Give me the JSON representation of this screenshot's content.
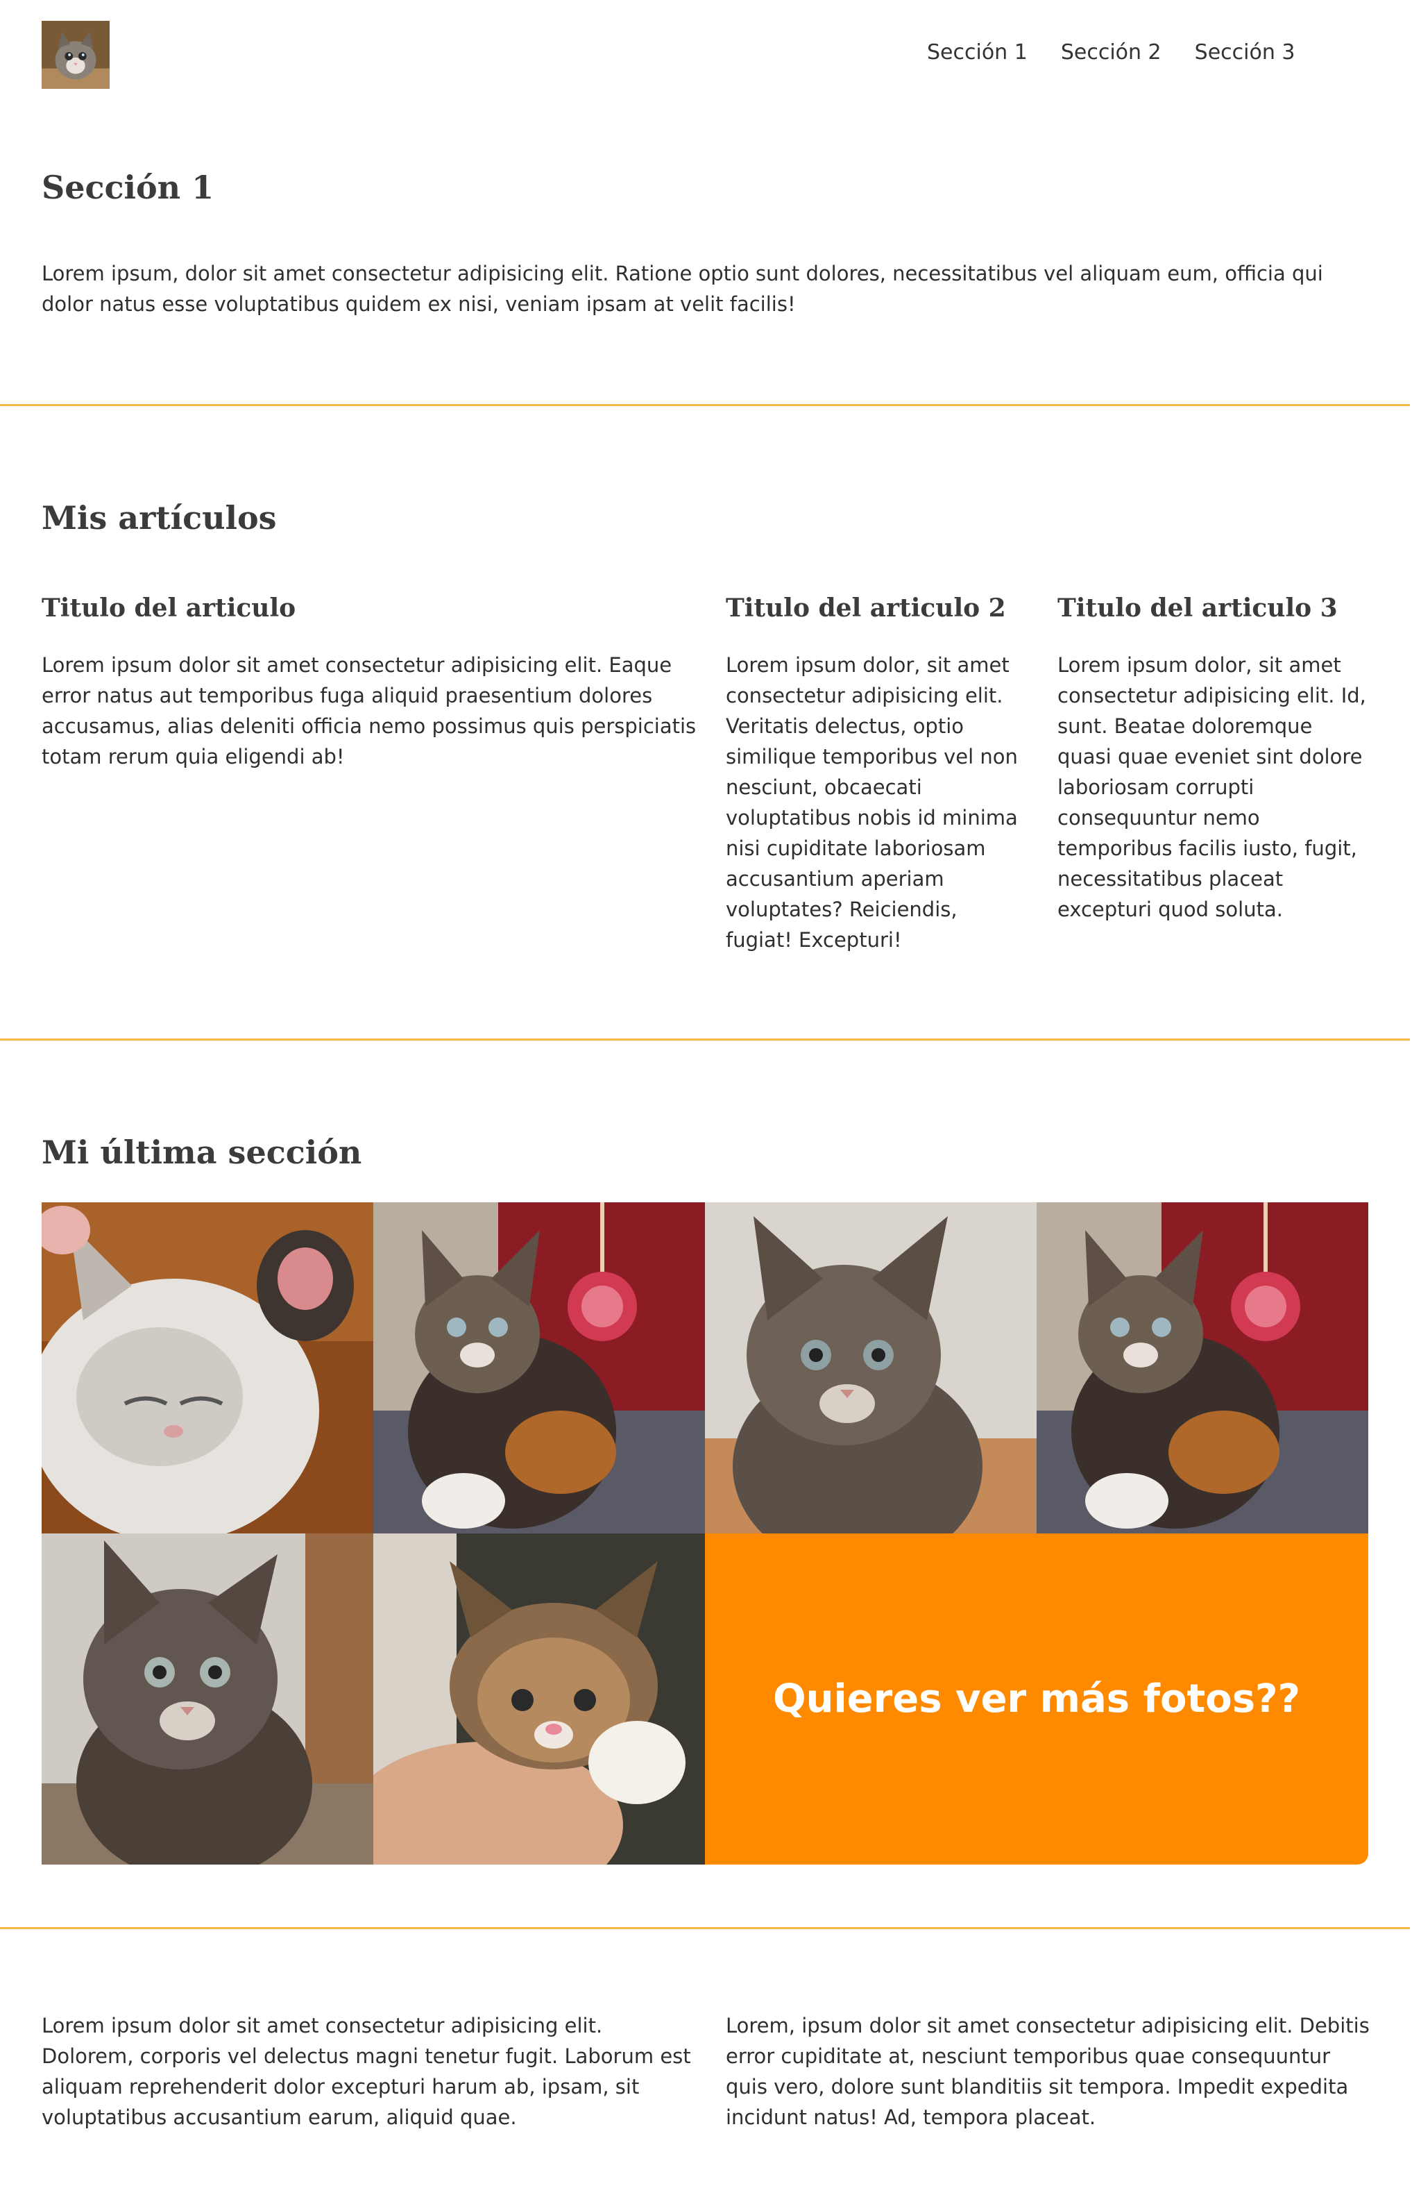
{
  "header": {
    "logo_name": "kitten-logo",
    "nav": [
      "Sección 1",
      "Sección 2",
      "Sección 3"
    ]
  },
  "section1": {
    "title": "Sección 1",
    "text": "Lorem ipsum, dolor sit amet consectetur adipisicing elit. Ratione optio sunt dolores, necessitatibus vel aliquam eum, officia qui dolor natus esse voluptatibus quidem ex nisi, veniam ipsam at velit facilis!"
  },
  "articles": {
    "title": "Mis artículos",
    "items": [
      {
        "title": "Titulo del articulo",
        "text": "Lorem ipsum dolor sit amet consectetur adipisicing elit. Eaque error natus aut temporibus fuga aliquid praesentium dolores accusamus, alias deleniti officia nemo possimus quis perspiciatis totam rerum quia eligendi ab!"
      },
      {
        "title": "Titulo del articulo 2",
        "text": "Lorem ipsum dolor, sit amet consectetur adipisicing elit. Veritatis delectus, optio similique temporibus vel non nesciunt, obcaecati voluptatibus nobis id minima nisi cupiditate laboriosam accusantium aperiam voluptates? Reiciendis, fugiat! Excepturi!"
      },
      {
        "title": "Titulo del articulo 3",
        "text": "Lorem ipsum dolor, sit amet consectetur adipisicing elit. Id, sunt. Beatae doloremque quasi quae eveniet sint dolore laboriosam corrupti consequuntur nemo temporibus facilis iusto, fugit, necessitatibus placeat excepturi quod soluta."
      }
    ]
  },
  "gallery": {
    "title": "Mi última sección",
    "cta_label": "Quieres ver más fotos??",
    "cta_color": "#ff8a00"
  },
  "footer": {
    "col1": "Lorem ipsum dolor sit amet consectetur adipisicing elit. Dolorem, corporis vel delectus magni tenetur fugit. Laborum est aliquam reprehenderit dolor excepturi harum ab, ipsam, sit voluptatibus accusantium earum, aliquid quae.",
    "col2": "Lorem, ipsum dolor sit amet consectetur adipisicing elit. Debitis error cupiditate at, nesciunt temporibus quae consequuntur quis vero, dolore sunt blanditiis sit tempora. Impedit expedita incidunt natus! Ad, tempora placeat."
  },
  "colors": {
    "divider": "#f5b745",
    "accent": "#ff8a00",
    "text": "#2f2f2f"
  }
}
